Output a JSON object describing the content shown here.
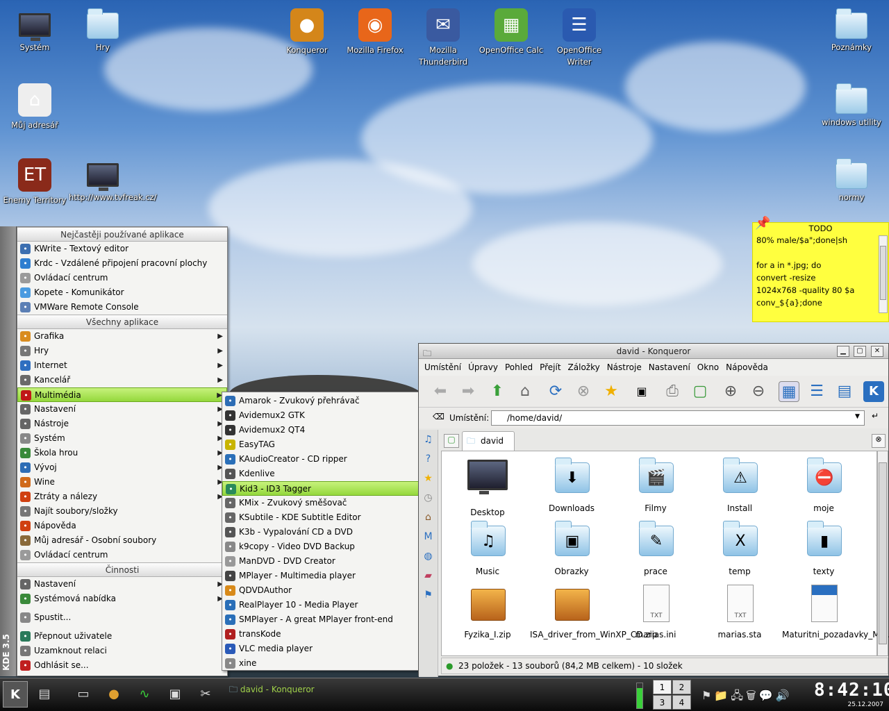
{
  "desktop": {
    "icons": [
      {
        "label": "Systém",
        "kind": "monitor"
      },
      {
        "label": "Hry",
        "kind": "folder"
      },
      {
        "label": "Konqueror",
        "kind": "globe"
      },
      {
        "label": "Mozilla Firefox",
        "kind": "firefox"
      },
      {
        "label": "Mozilla Thunderbird",
        "kind": "thunderbird"
      },
      {
        "label": "OpenOffice Calc",
        "kind": "calc"
      },
      {
        "label": "OpenOffice Writer",
        "kind": "writer"
      },
      {
        "label": "Poznámky",
        "kind": "folder"
      },
      {
        "label": "Můj adresář",
        "kind": "home"
      },
      {
        "label": "windows utility",
        "kind": "folder"
      },
      {
        "label": "Enemy Territory",
        "kind": "game"
      },
      {
        "label": "http://www.tvfreak.cz/",
        "kind": "monitor"
      },
      {
        "label": "normy",
        "kind": "folder"
      }
    ]
  },
  "note": {
    "title": "TODO",
    "body": "80% male/$a\";done|sh\n\nfor a in *.jpg; do\nconvert -resize\n1024x768 -quality 80 $a\nconv_${a};done"
  },
  "kmenu": {
    "version_label": "KDE 3.5",
    "header_frequent": "Nejčastěji používané aplikace",
    "frequent": [
      {
        "label": "KWrite - Textový editor",
        "icon": "edit-icon",
        "color": "#3c6fb0"
      },
      {
        "label": "Krdc - Vzdálené připojení pracovní plochy",
        "icon": "remote-desktop-icon",
        "color": "#2f7ed0"
      },
      {
        "label": "Ovládací centrum",
        "icon": "control-center-icon",
        "color": "#9a9a9a"
      },
      {
        "label": "Kopete - Komunikátor",
        "icon": "chat-icon",
        "color": "#4a9be0"
      },
      {
        "label": "VMWare Remote Console",
        "icon": "vmware-icon",
        "color": "#5b7fb5"
      }
    ],
    "header_all": "Všechny aplikace",
    "all": [
      {
        "label": "Grafika",
        "icon": "graphics-icon",
        "color": "#d98c1f",
        "sub": true
      },
      {
        "label": "Hry",
        "icon": "games-icon",
        "color": "#777",
        "sub": true
      },
      {
        "label": "Internet",
        "icon": "internet-icon",
        "color": "#2f6fc0",
        "sub": true
      },
      {
        "label": "Kancelář",
        "icon": "office-icon",
        "color": "#6a6a6a",
        "sub": true
      },
      {
        "label": "Multimédia",
        "icon": "multimedia-icon",
        "color": "#c01818",
        "sub": true,
        "selected": true
      },
      {
        "label": "Nastavení",
        "icon": "settings-icon",
        "color": "#666",
        "sub": true
      },
      {
        "label": "Nástroje",
        "icon": "tools-icon",
        "color": "#666",
        "sub": true
      },
      {
        "label": "Systém",
        "icon": "system-icon",
        "color": "#888",
        "sub": true
      },
      {
        "label": "Škola hrou",
        "icon": "education-icon",
        "color": "#3a8a3a",
        "sub": true
      },
      {
        "label": "Vývoj",
        "icon": "development-icon",
        "color": "#2d6db5",
        "sub": true
      },
      {
        "label": "Wine",
        "icon": "wine-icon",
        "color": "#d06a1a",
        "sub": true
      },
      {
        "label": "Ztráty a nálezy",
        "icon": "lost-found-icon",
        "color": "#d04010",
        "sub": true
      },
      {
        "label": "Najít soubory/složky",
        "icon": "find-icon",
        "color": "#777",
        "sub": false
      },
      {
        "label": "Nápověda",
        "icon": "help-icon",
        "color": "#d04010",
        "sub": false
      },
      {
        "label": "Můj adresář - Osobní soubory",
        "icon": "home-icon",
        "color": "#8a6a3a",
        "sub": false
      },
      {
        "label": "Ovládací centrum",
        "icon": "control-center-icon",
        "color": "#9a9a9a",
        "sub": false
      }
    ],
    "header_actions": "Činnosti",
    "actions": [
      {
        "label": "Nastavení",
        "icon": "settings-icon",
        "color": "#666",
        "sub": true
      },
      {
        "label": "Systémová nabídka",
        "icon": "system-menu-icon",
        "color": "#3a8a3a",
        "sub": true
      }
    ],
    "run": {
      "label": "Spustit...",
      "icon": "run-icon",
      "color": "#888"
    },
    "session": [
      {
        "label": "Přepnout uživatele",
        "icon": "switch-user-icon",
        "color": "#2a7a5a"
      },
      {
        "label": "Uzamknout relaci",
        "icon": "lock-icon",
        "color": "#777"
      },
      {
        "label": "Odhlásit se...",
        "icon": "logout-icon",
        "color": "#c02020"
      }
    ]
  },
  "submenu": {
    "items": [
      {
        "label": "Amarok - Zvukový přehrávač",
        "icon": "amarok-icon",
        "color": "#2d6db5"
      },
      {
        "label": "Avidemux2 GTK",
        "icon": "avidemux-icon",
        "color": "#333"
      },
      {
        "label": "Avidemux2 QT4",
        "icon": "avidemux-icon",
        "color": "#333"
      },
      {
        "label": "EasyTAG",
        "icon": "easytag-icon",
        "color": "#c8b400"
      },
      {
        "label": "KAudioCreator - CD ripper",
        "icon": "cd-icon",
        "color": "#2a6fb8"
      },
      {
        "label": "Kdenlive",
        "icon": "kdenlive-icon",
        "color": "#555"
      },
      {
        "label": "Kid3 - ID3 Tagger",
        "icon": "kid3-icon",
        "color": "#2a8a5a",
        "selected": true
      },
      {
        "label": "KMix - Zvukový směšovač",
        "icon": "mixer-icon",
        "color": "#666"
      },
      {
        "label": "KSubtile - KDE Subtitle Editor",
        "icon": "subtitle-icon",
        "color": "#666"
      },
      {
        "label": "K3b - Vypalování CD a DVD",
        "icon": "k3b-icon",
        "color": "#555"
      },
      {
        "label": "k9copy - Video DVD Backup",
        "icon": "dvd-icon",
        "color": "#888"
      },
      {
        "label": "ManDVD - DVD Creator",
        "icon": "dvd-icon",
        "color": "#999"
      },
      {
        "label": "MPlayer - Multimedia player",
        "icon": "mplayer-icon",
        "color": "#444"
      },
      {
        "label": "QDVDAuthor",
        "icon": "qdvd-icon",
        "color": "#d88a1a"
      },
      {
        "label": "RealPlayer 10 - Media Player",
        "icon": "real-icon",
        "color": "#2a6fb8"
      },
      {
        "label": "SMPlayer - A great MPlayer front-end",
        "icon": "smplayer-icon",
        "color": "#2a6fb8"
      },
      {
        "label": "transKode",
        "icon": "transkode-icon",
        "color": "#b02020"
      },
      {
        "label": "VLC media player",
        "icon": "vlc-icon",
        "color": "#2a5ab8"
      },
      {
        "label": "xine",
        "icon": "xine-icon",
        "color": "#888"
      }
    ]
  },
  "konqueror": {
    "title": "david - Konqueror",
    "menubar": [
      "Umístění",
      "Úpravy",
      "Pohled",
      "Přejít",
      "Záložky",
      "Nástroje",
      "Nastavení",
      "Okno",
      "Nápověda"
    ],
    "location_label": "Umístění:",
    "location_value": "/home/david/",
    "tab_label": "david",
    "files": [
      {
        "label": "Desktop",
        "kind": "monitor"
      },
      {
        "label": "Downloads",
        "kind": "folder",
        "emblem": "⬇"
      },
      {
        "label": "Filmy",
        "kind": "folder",
        "emblem": "🎬"
      },
      {
        "label": "Install",
        "kind": "folder",
        "emblem": "⚠"
      },
      {
        "label": "moje",
        "kind": "folder",
        "emblem": "⛔"
      },
      {
        "label": "Music",
        "kind": "folder",
        "emblem": "♫"
      },
      {
        "label": "Obrazky",
        "kind": "folder",
        "emblem": "▣"
      },
      {
        "label": "prace",
        "kind": "folder",
        "emblem": "✎"
      },
      {
        "label": "temp",
        "kind": "folder",
        "emblem": "X"
      },
      {
        "label": "texty",
        "kind": "folder",
        "emblem": "▮"
      },
      {
        "label": "Fyzika_I.zip",
        "kind": "box"
      },
      {
        "label": "ISA_driver_from_WinXP_CD.zip",
        "kind": "box"
      },
      {
        "label": "marias.ini",
        "kind": "txt"
      },
      {
        "label": "marias.sta",
        "kind": "txt"
      },
      {
        "label": "Maturitni_pozadavky_MS...",
        "kind": "doc"
      }
    ],
    "status": "23 položek - 13 souborů (84,2 MB celkem) - 10 složek"
  },
  "taskbar": {
    "task_label": "david - Konqueror",
    "pager": [
      "1",
      "2",
      "3",
      "4"
    ],
    "clock": "8:42:10",
    "date": "25.12.2007"
  },
  "colors": {
    "menu_selection": "#a4e04a",
    "note": "#ffff3f"
  }
}
